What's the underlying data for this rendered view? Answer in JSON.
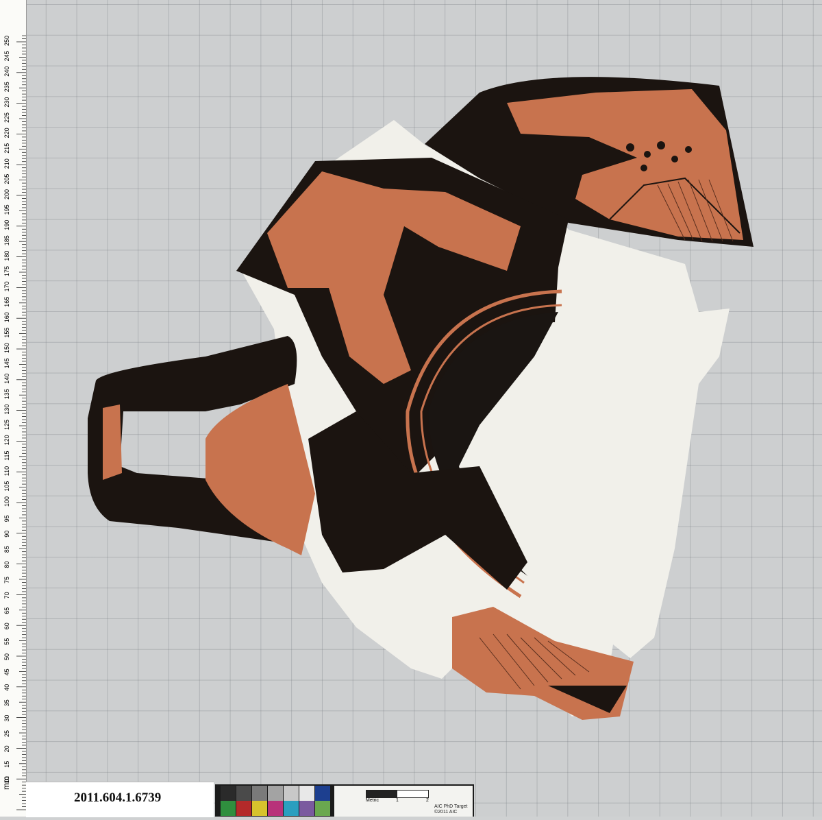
{
  "accession_number": "2011.604.1.6739",
  "ruler": {
    "unit_label": "mm",
    "tick_labels": [
      "10",
      "15",
      "20",
      "25",
      "30",
      "35",
      "40",
      "45",
      "50",
      "55",
      "60",
      "65",
      "70",
      "75",
      "80",
      "85",
      "90",
      "95",
      "100",
      "105",
      "110",
      "115",
      "120",
      "125",
      "130",
      "135",
      "140",
      "145",
      "150",
      "155",
      "160",
      "165",
      "170",
      "175",
      "180",
      "185",
      "190",
      "195",
      "200",
      "205",
      "210",
      "215",
      "220",
      "225",
      "230",
      "235",
      "240",
      "245",
      "250"
    ]
  },
  "color_target": {
    "title": "AIC PhD Target",
    "copyright": "©2011 AIC",
    "scale_labels": [
      "Metric",
      "1",
      "2"
    ],
    "swatches": [
      "#2a2a2a",
      "#4a4a4a",
      "#7a7a7a",
      "#a3a3a3",
      "#c8c8c8",
      "#e8e8e8",
      "#1d3f8f",
      "#2f8f3e",
      "#b42a2a",
      "#d7c32d",
      "#b8327a",
      "#2a9fbf",
      "#7a5a9f",
      "#6aa84f"
    ]
  },
  "object": {
    "description_icon": "red-figure-cup-fragment",
    "colors": {
      "terracotta": "#c8734e",
      "black_glaze": "#1b1410",
      "plaster": "#f2f1ec"
    }
  }
}
